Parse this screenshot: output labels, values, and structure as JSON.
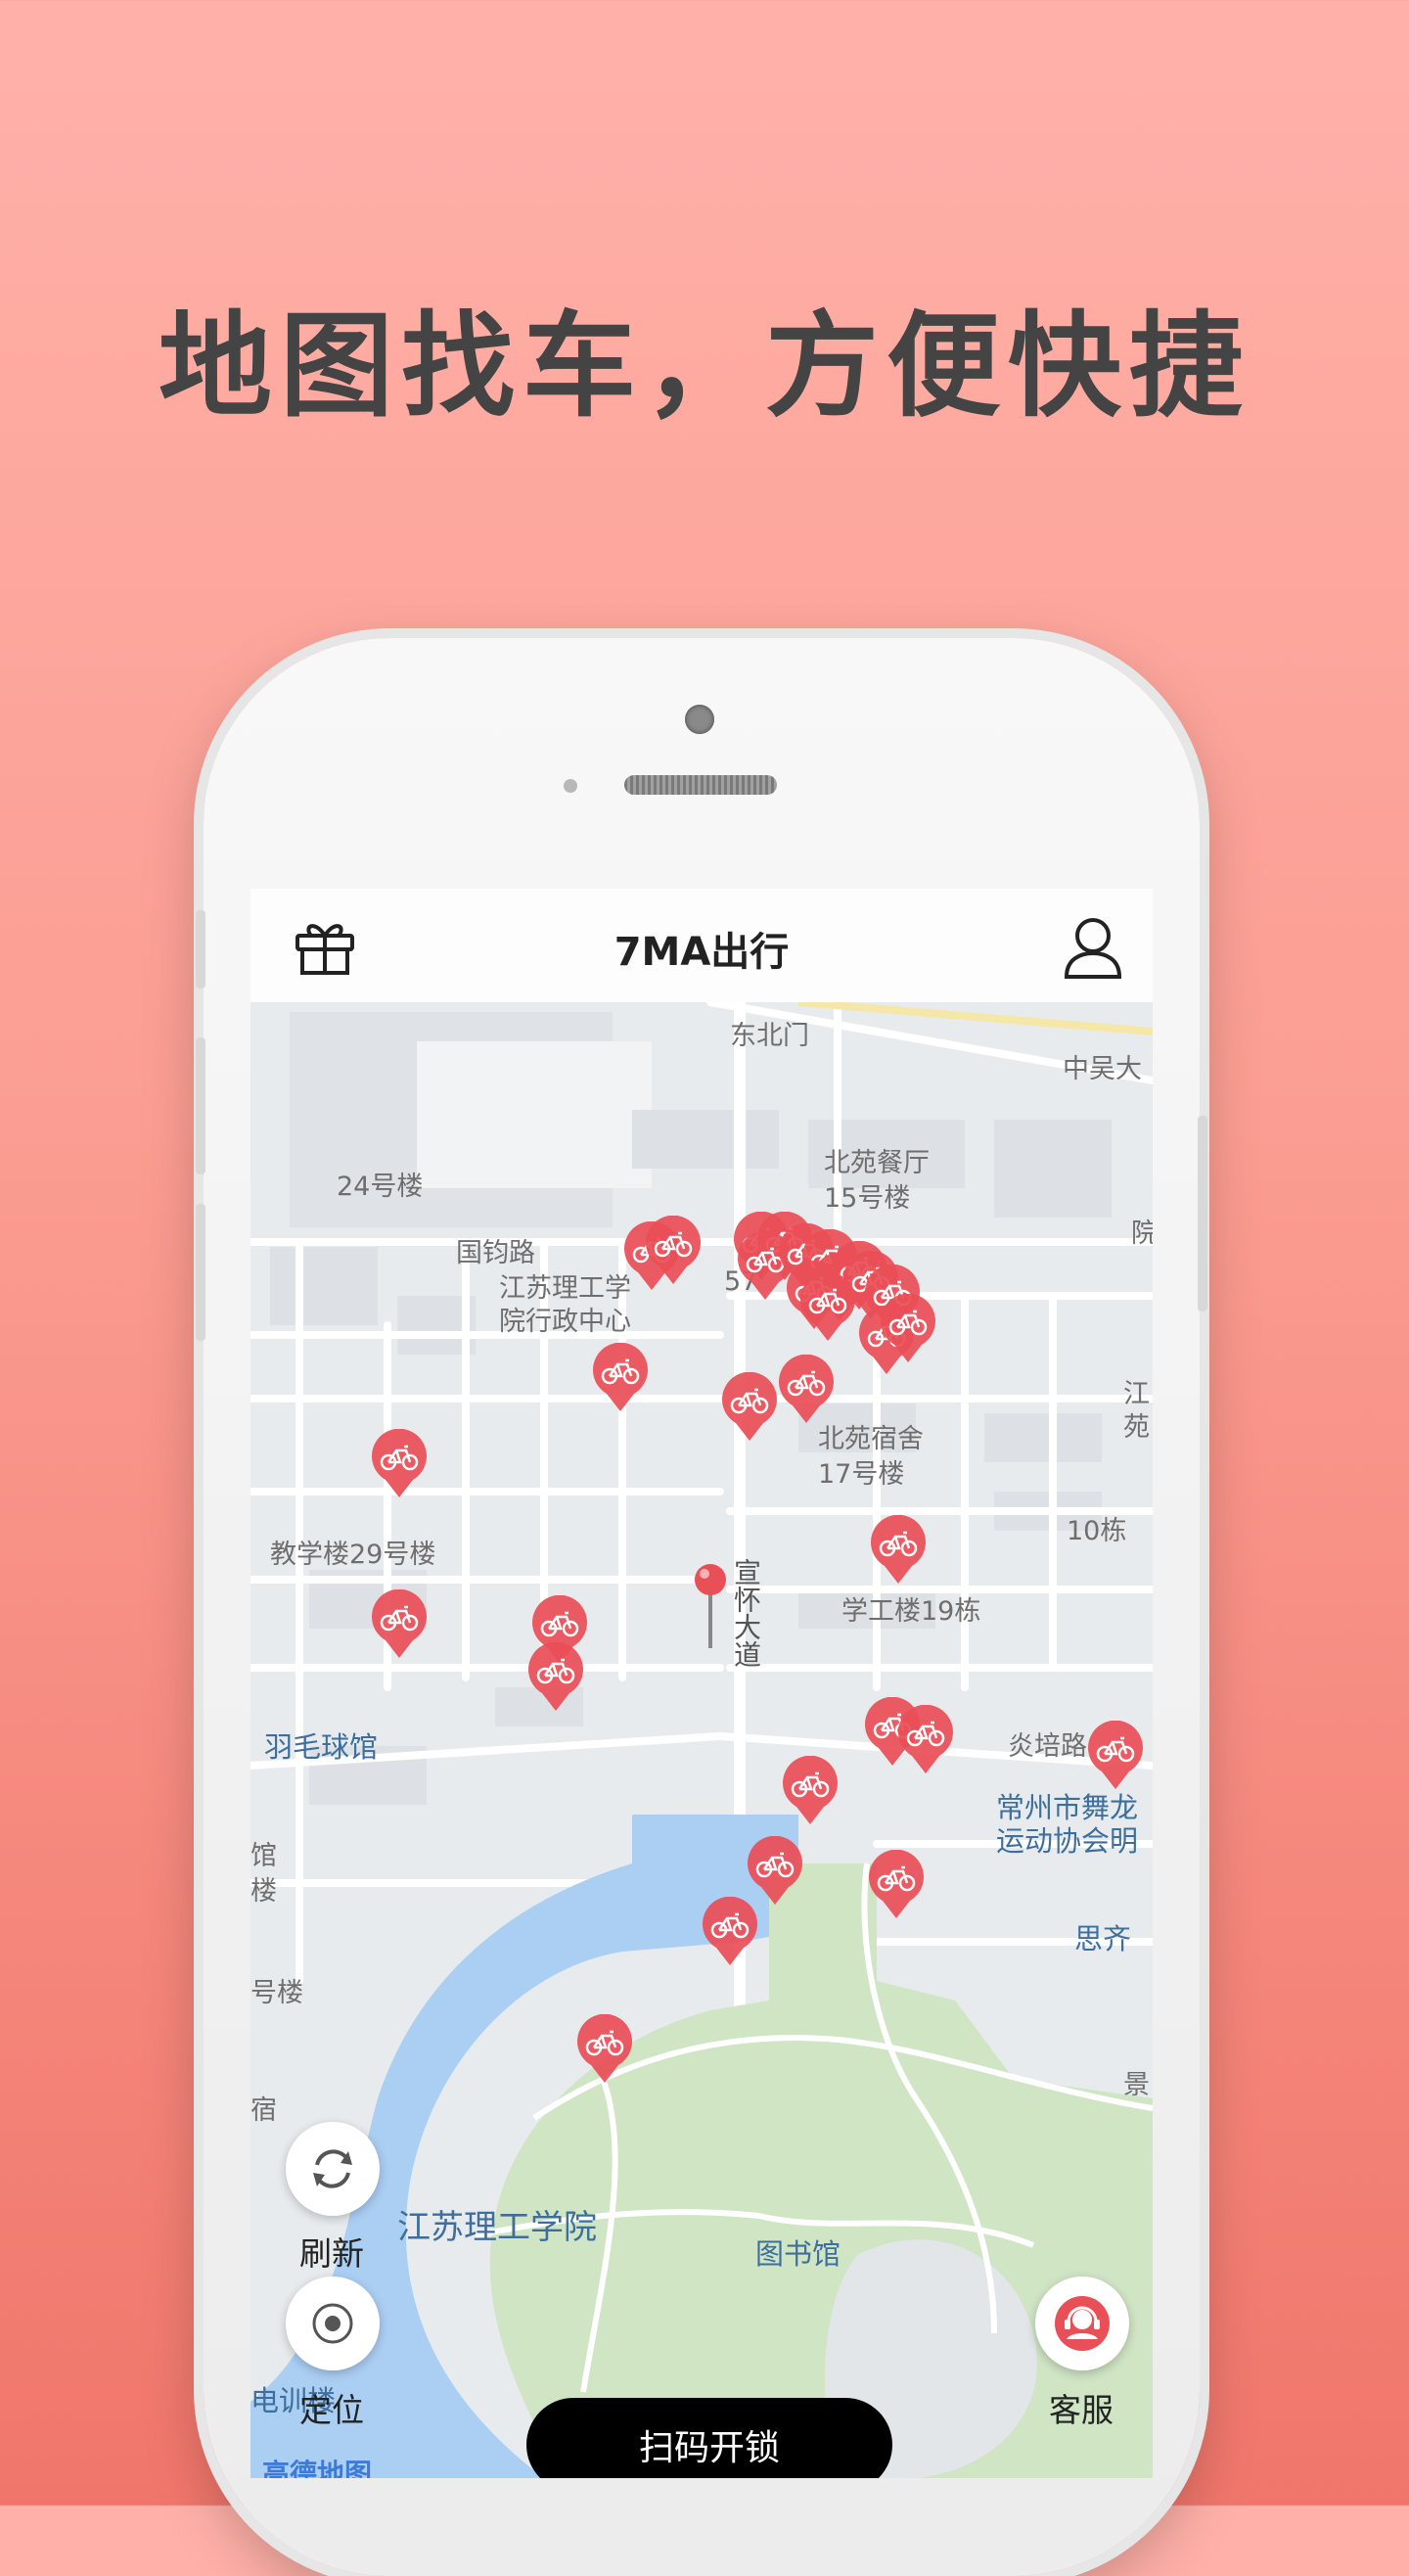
{
  "headline": "地图找车，方便快捷",
  "app": {
    "title": "7MA出行",
    "gift_icon": "gift-icon",
    "user_icon": "user-icon"
  },
  "map": {
    "labels": {
      "north_gate": "东北门",
      "zhongwu": "中吴大",
      "beiyuan_canteen": "北苑餐厅",
      "canteen_building": "15号楼",
      "building24": "24号楼",
      "guojun_road": "国钧路",
      "admin_center_1": "江苏理工学",
      "admin_center_2": "院行政中心",
      "num57": "57",
      "beiyuan_dorm": "北苑宿舍",
      "building17": "17号楼",
      "teaching29": "教学楼29号楼",
      "building10": "10栋",
      "xuangong19": "学工楼19栋",
      "xuanhuai_road": "宣怀大道",
      "badminton": "羽毛球馆",
      "yanpei_road": "炎培路",
      "wulong_1": "常州市舞龙",
      "wulong_2": "运动协会明",
      "siqi": "思齐",
      "university": "江苏理工学院",
      "library": "图书馆",
      "left_guan": "馆",
      "left_lou": "楼",
      "left_haolou": "号楼",
      "left_su": "宿",
      "right_jiang": "江",
      "right_yuan": "苑",
      "right_yuan2": "院",
      "right_jing": "景",
      "training": "电训楼"
    },
    "logo": "高德地图"
  },
  "controls": {
    "refresh_label": "刷新",
    "locate_label": "定位",
    "scan_label": "扫码开锁",
    "service_label": "客服"
  },
  "colors": {
    "accent": "#e94f57",
    "water": "#abcef3",
    "park": "#cfe5c4"
  }
}
